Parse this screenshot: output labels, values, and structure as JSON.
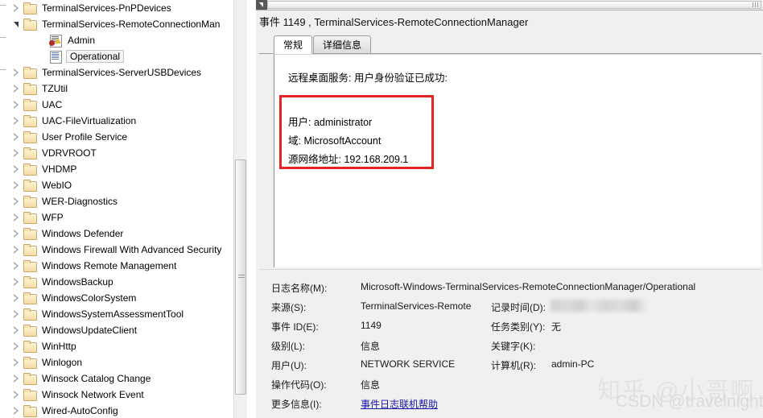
{
  "tree": {
    "items": [
      {
        "label": "TerminalServices-PnPDevices",
        "indent": 14,
        "state": "collapsed",
        "icon": "folder-icon",
        "selected": false
      },
      {
        "label": "TerminalServices-RemoteConnectionMan",
        "indent": 14,
        "state": "expanded",
        "icon": "folder-icon",
        "selected": false
      },
      {
        "label": "Admin",
        "indent": 46,
        "state": "leaf",
        "icon": "admin-log-icon",
        "selected": false
      },
      {
        "label": "Operational",
        "indent": 46,
        "state": "leaf",
        "icon": "log-icon",
        "selected": true
      },
      {
        "label": "TerminalServices-ServerUSBDevices",
        "indent": 14,
        "state": "collapsed",
        "icon": "folder-icon",
        "selected": false
      },
      {
        "label": "TZUtil",
        "indent": 14,
        "state": "collapsed",
        "icon": "folder-icon",
        "selected": false
      },
      {
        "label": "UAC",
        "indent": 14,
        "state": "collapsed",
        "icon": "folder-icon",
        "selected": false
      },
      {
        "label": "UAC-FileVirtualization",
        "indent": 14,
        "state": "collapsed",
        "icon": "folder-icon",
        "selected": false
      },
      {
        "label": "User Profile Service",
        "indent": 14,
        "state": "collapsed",
        "icon": "folder-icon",
        "selected": false
      },
      {
        "label": "VDRVROOT",
        "indent": 14,
        "state": "collapsed",
        "icon": "folder-icon",
        "selected": false
      },
      {
        "label": "VHDMP",
        "indent": 14,
        "state": "collapsed",
        "icon": "folder-icon",
        "selected": false
      },
      {
        "label": "WebIO",
        "indent": 14,
        "state": "collapsed",
        "icon": "folder-icon",
        "selected": false
      },
      {
        "label": "WER-Diagnostics",
        "indent": 14,
        "state": "collapsed",
        "icon": "folder-icon",
        "selected": false
      },
      {
        "label": "WFP",
        "indent": 14,
        "state": "collapsed",
        "icon": "folder-icon",
        "selected": false
      },
      {
        "label": "Windows Defender",
        "indent": 14,
        "state": "collapsed",
        "icon": "folder-icon",
        "selected": false
      },
      {
        "label": "Windows Firewall With Advanced Security",
        "indent": 14,
        "state": "collapsed",
        "icon": "folder-icon",
        "selected": false
      },
      {
        "label": "Windows Remote Management",
        "indent": 14,
        "state": "collapsed",
        "icon": "folder-icon",
        "selected": false
      },
      {
        "label": "WindowsBackup",
        "indent": 14,
        "state": "collapsed",
        "icon": "folder-icon",
        "selected": false
      },
      {
        "label": "WindowsColorSystem",
        "indent": 14,
        "state": "collapsed",
        "icon": "folder-icon",
        "selected": false
      },
      {
        "label": "WindowsSystemAssessmentTool",
        "indent": 14,
        "state": "collapsed",
        "icon": "folder-icon",
        "selected": false
      },
      {
        "label": "WindowsUpdateClient",
        "indent": 14,
        "state": "collapsed",
        "icon": "folder-icon",
        "selected": false
      },
      {
        "label": "WinHttp",
        "indent": 14,
        "state": "collapsed",
        "icon": "folder-icon",
        "selected": false
      },
      {
        "label": "Winlogon",
        "indent": 14,
        "state": "collapsed",
        "icon": "folder-icon",
        "selected": false
      },
      {
        "label": "Winsock Catalog Change",
        "indent": 14,
        "state": "collapsed",
        "icon": "folder-icon",
        "selected": false
      },
      {
        "label": "Winsock Network Event",
        "indent": 14,
        "state": "collapsed",
        "icon": "folder-icon",
        "selected": false
      },
      {
        "label": "Wired-AutoConfig",
        "indent": 14,
        "state": "collapsed",
        "icon": "folder-icon",
        "selected": false
      }
    ]
  },
  "event": {
    "title": "事件 1149 , TerminalServices-RemoteConnectionManager",
    "tabs": [
      {
        "label": "常规",
        "active": true
      },
      {
        "label": "详细信息",
        "active": false
      }
    ],
    "description": {
      "heading": "远程桌面服务: 用户身份验证已成功:",
      "lines": [
        "用户: administrator",
        "域: MicrosoftAccount",
        "源网络地址: 192.168.209.1"
      ]
    },
    "details": {
      "left": [
        {
          "label": "日志名称(M):",
          "value": "Microsoft-Windows-TerminalServices-RemoteConnectionManager/Operational"
        },
        {
          "label": "来源(S):",
          "value": "TerminalServices-Remote"
        },
        {
          "label": "事件 ID(E):",
          "value": "1149"
        },
        {
          "label": "级别(L):",
          "value": "信息"
        },
        {
          "label": "用户(U):",
          "value": "NETWORK SERVICE"
        },
        {
          "label": "操作代码(O):",
          "value": "信息"
        },
        {
          "label": "更多信息(I):",
          "value": "事件日志联机帮助",
          "link": true
        }
      ],
      "right": [
        {
          "label": "记录时间(D):",
          "value": ""
        },
        {
          "label": "任务类别(Y):",
          "value": "无"
        },
        {
          "label": "关键字(K):",
          "value": ""
        },
        {
          "label": "计算机(R):",
          "value": "admin-PC"
        }
      ]
    }
  },
  "watermark": {
    "zhihu": "知乎 @小哥啊",
    "csdn": "CSDN @travelnight"
  },
  "colors": {
    "red_highlight": "#e32222",
    "link": "#1414a8",
    "pane_bg": "#f0f0ef",
    "folder": "#f3dca4"
  }
}
